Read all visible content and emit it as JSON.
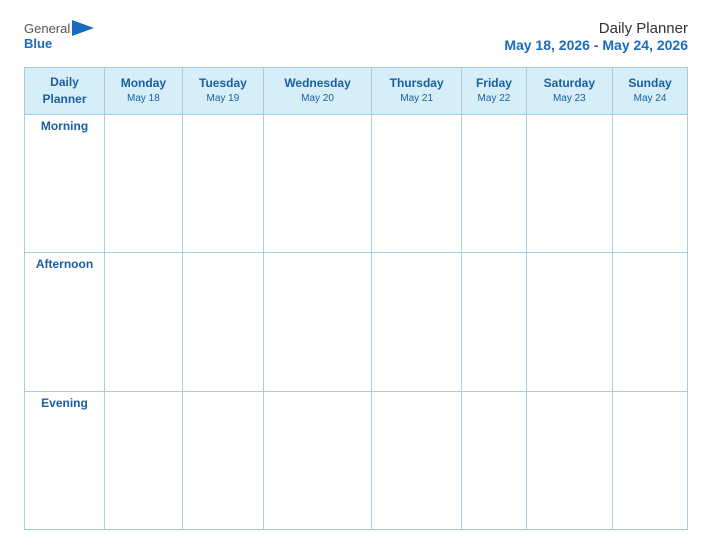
{
  "logo": {
    "general": "General",
    "blue": "Blue",
    "icon": "▶"
  },
  "title": {
    "main": "Daily Planner",
    "date_range": "May 18, 2026 - May 24, 2026"
  },
  "table": {
    "header_label": "Daily Planner",
    "columns": [
      {
        "day": "Monday",
        "date": "May 18"
      },
      {
        "day": "Tuesday",
        "date": "May 19"
      },
      {
        "day": "Wednesday",
        "date": "May 20"
      },
      {
        "day": "Thursday",
        "date": "May 21"
      },
      {
        "day": "Friday",
        "date": "May 22"
      },
      {
        "day": "Saturday",
        "date": "May 23"
      },
      {
        "day": "Sunday",
        "date": "May 24"
      }
    ],
    "rows": [
      {
        "label": "Morning"
      },
      {
        "label": "Afternoon"
      },
      {
        "label": "Evening"
      }
    ]
  }
}
